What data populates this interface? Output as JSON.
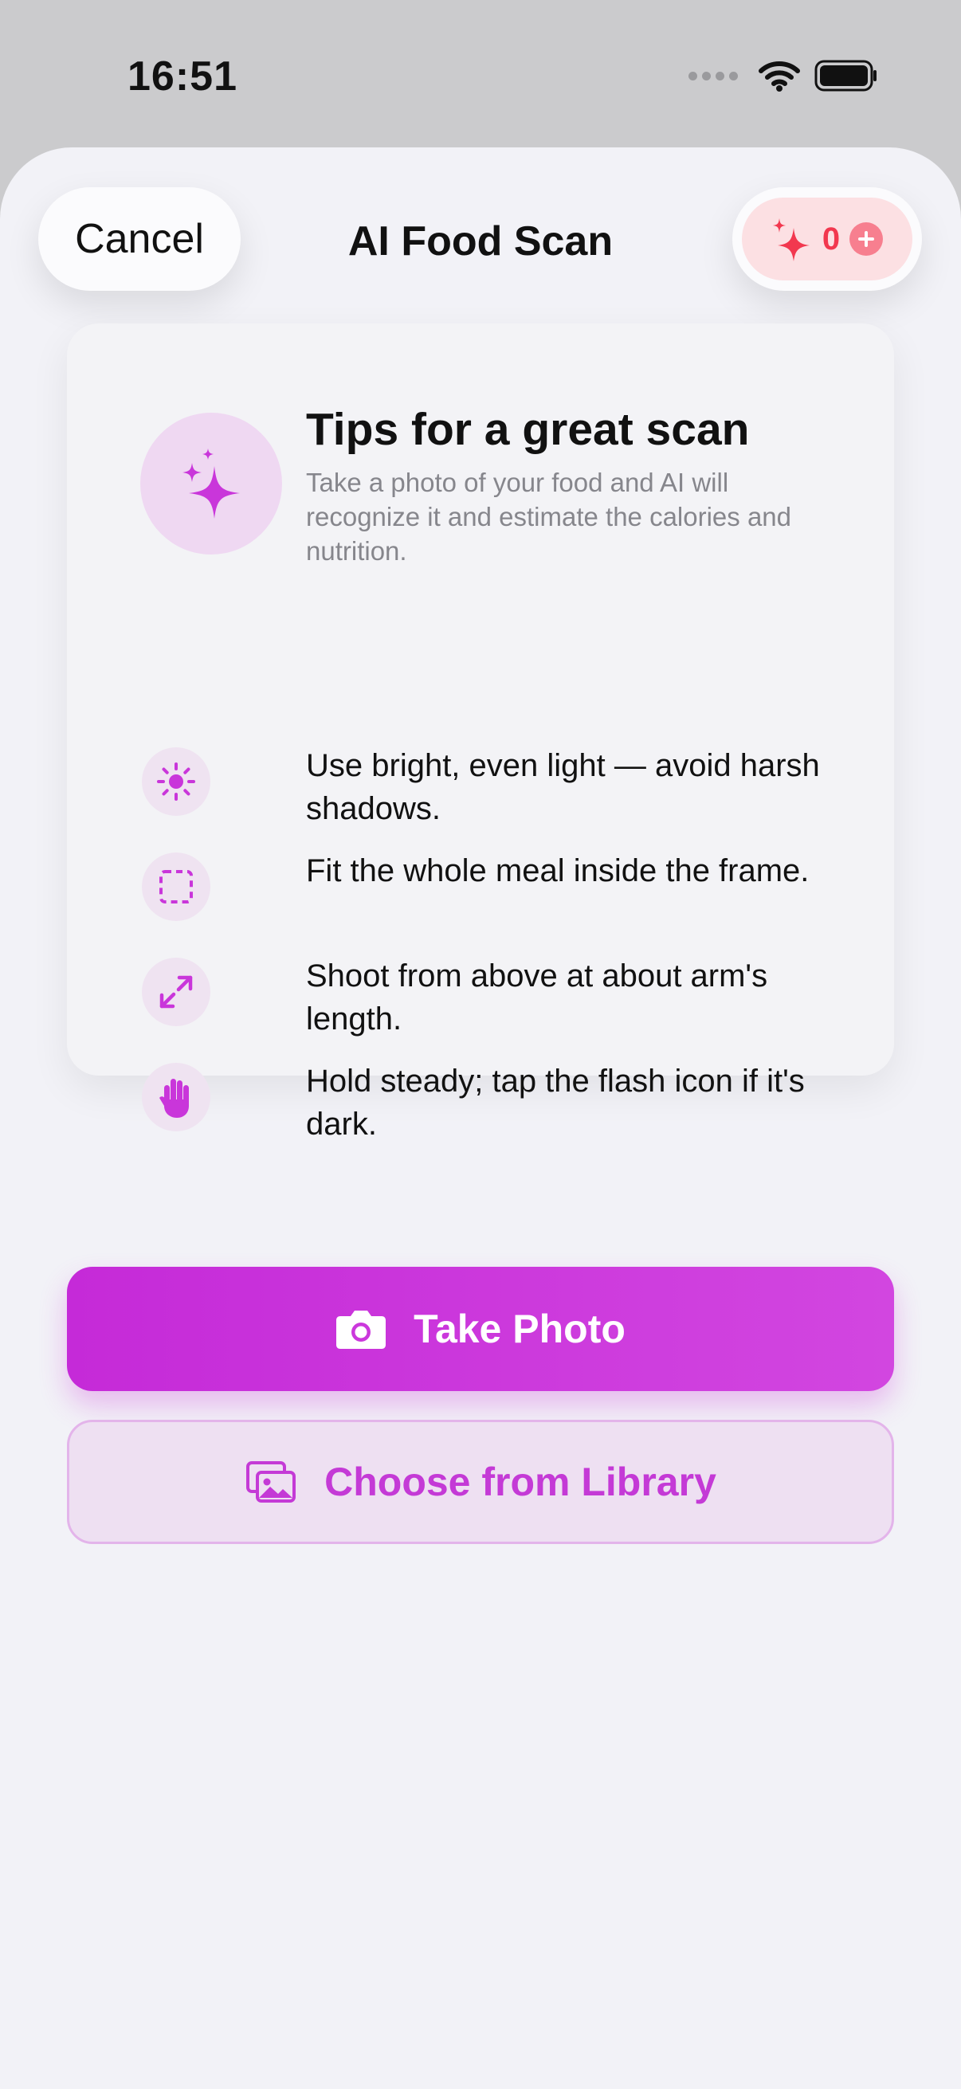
{
  "status_bar": {
    "time": "16:51"
  },
  "nav": {
    "cancel_label": "Cancel",
    "title": "AI Food Scan",
    "credits_count": "0"
  },
  "tips": {
    "title": "Tips for a great scan",
    "subtitle": "Take a photo of your food and AI will recognize it and estimate the calories and nutrition.",
    "items": [
      {
        "icon": "sun-icon",
        "text": "Use bright, even light — avoid harsh shadows."
      },
      {
        "icon": "frame-icon",
        "text": "Fit the whole meal inside the frame."
      },
      {
        "icon": "expand-arrows-icon",
        "text": "Shoot from above at about arm's length."
      },
      {
        "icon": "hand-icon",
        "text": "Hold steady; tap the flash icon if it's dark."
      }
    ]
  },
  "actions": {
    "take_photo_label": "Take Photo",
    "library_label": "Choose from Library"
  },
  "colors": {
    "accent": "#C936DA",
    "credits": "#F2384F",
    "background": "#F2F2F7"
  }
}
